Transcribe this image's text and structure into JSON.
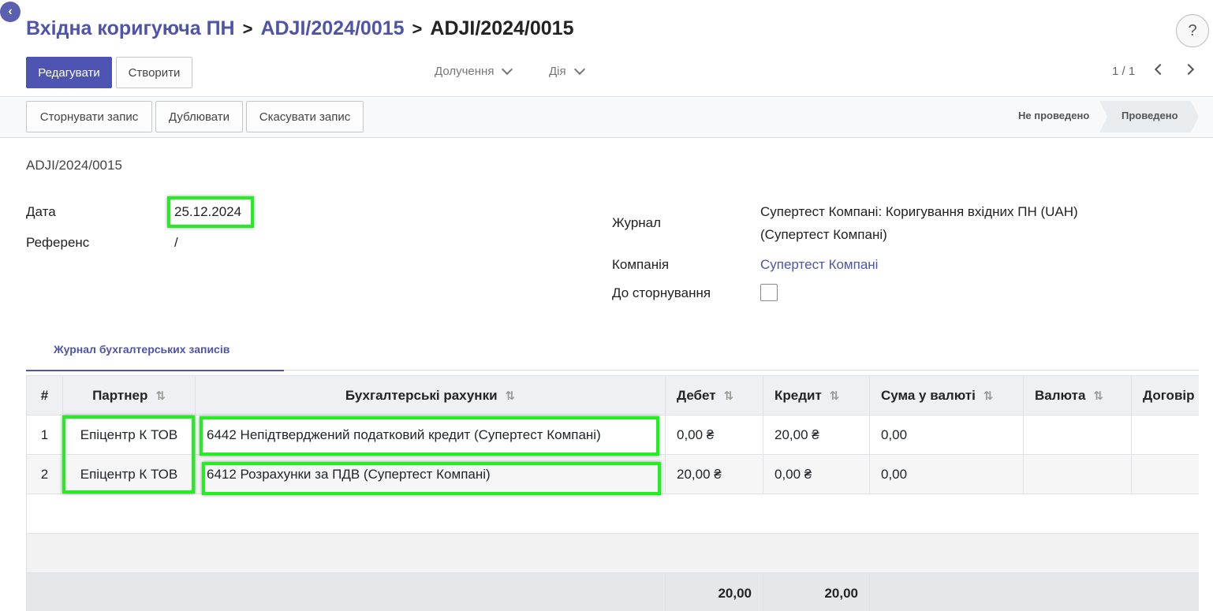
{
  "breadcrumb": {
    "items": [
      "Вхідна коригуюча ПН",
      "ADJI/2024/0015"
    ],
    "current": "ADJI/2024/0015",
    "separator": ">"
  },
  "help_label": "?",
  "back_label": "‹",
  "toolbar": {
    "edit_label": "Редагувати",
    "create_label": "Створити",
    "attachments_label": "Долучення",
    "action_label": "Дія",
    "pager": "1 / 1"
  },
  "actions": {
    "reverse_label": "Сторнувати запис",
    "duplicate_label": "Дублювати",
    "cancel_label": "Скасувати запис"
  },
  "status": {
    "stages": [
      "Не проведено",
      "Проведено"
    ],
    "active": "Проведено"
  },
  "form": {
    "reference_title": "ADJI/2024/0015",
    "date_label": "Дата",
    "date_value": "25.12.2024",
    "ref_label": "Референс",
    "ref_value": "/",
    "journal_label": "Журнал",
    "journal_value_line1": "Супертест Компані: Коригування вхідних ПН (UAH)",
    "journal_value_line2": "(Супертест Компані)",
    "company_label": "Компанія",
    "company_value": "Супертест Компані",
    "to_reverse_label": "До сторнування"
  },
  "tabs": [
    "Журнал бухгалтерських записів"
  ],
  "table": {
    "columns": [
      "#",
      "Партнер",
      "Бухгалтерські рахунки",
      "Дебет",
      "Кредит",
      "Сума у валюті",
      "Валюта",
      "Договір"
    ],
    "rows": [
      {
        "n": "1",
        "partner": "Епіцентр К ТОВ",
        "account": "6442 Непідтверджений податковий кредит (Супертест Компані)",
        "debit": "0,00 ₴",
        "credit": "20,00 ₴",
        "amount_currency": "0,00",
        "currency": "",
        "contract": ""
      },
      {
        "n": "2",
        "partner": "Епіцентр К ТОВ",
        "account": "6412 Розрахунки за ПДВ (Супертест Компані)",
        "debit": "20,00 ₴",
        "credit": "0,00 ₴",
        "amount_currency": "0,00",
        "currency": "",
        "contract": ""
      }
    ],
    "totals": {
      "debit": "20,00",
      "credit": "20,00"
    }
  },
  "colors": {
    "accent": "#4e54a8",
    "highlight": "#22ee22"
  }
}
